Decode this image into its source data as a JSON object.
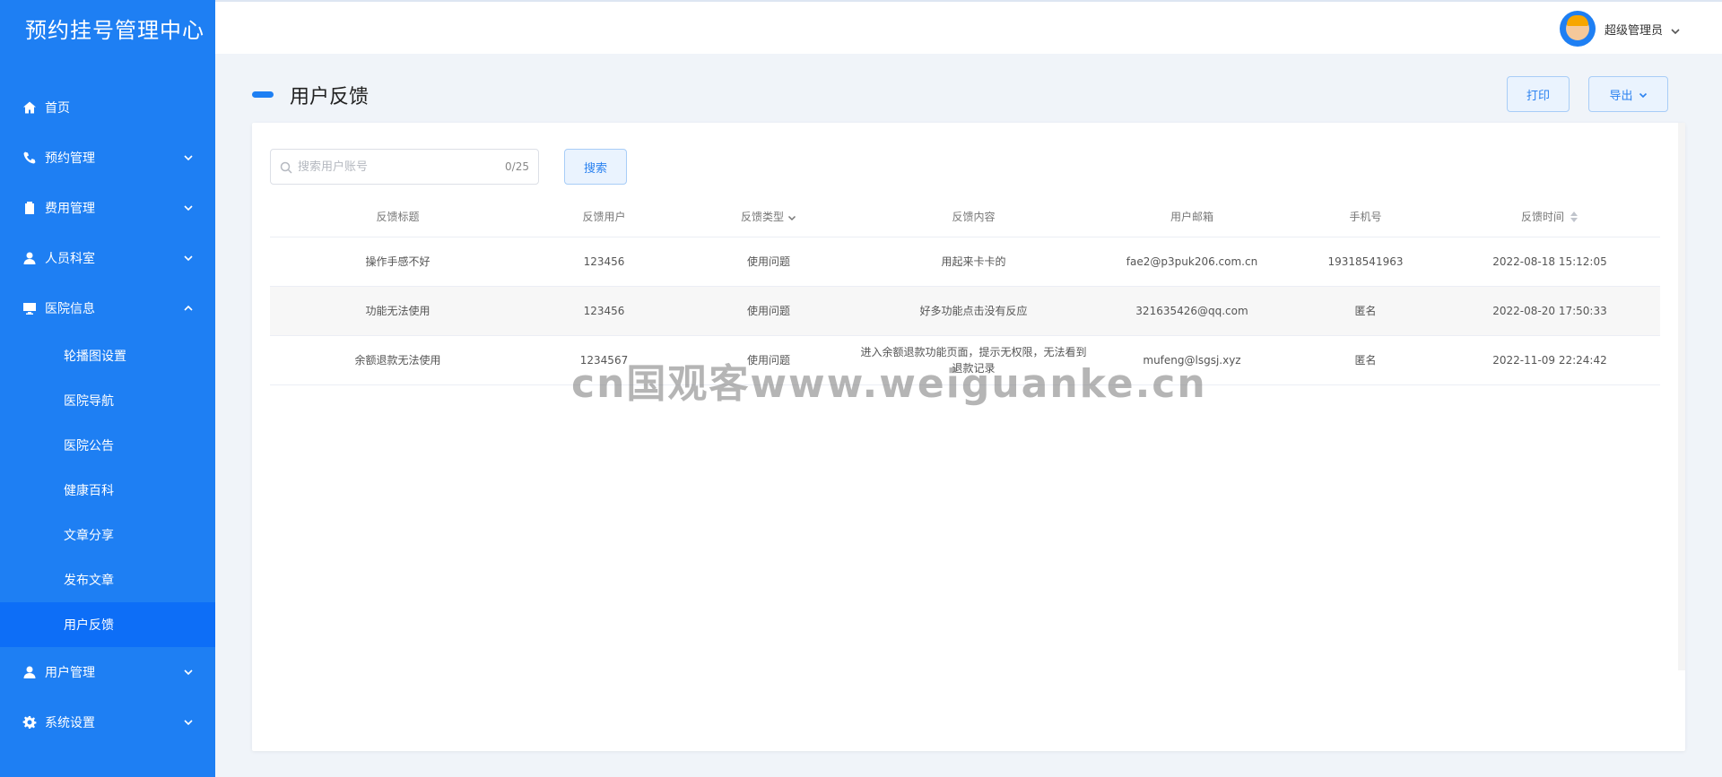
{
  "app": {
    "brand": "预约挂号管理中心"
  },
  "sidebar": {
    "items": [
      {
        "label": "首页",
        "icon": "home-icon"
      },
      {
        "label": "预约管理",
        "icon": "phone-icon"
      },
      {
        "label": "费用管理",
        "icon": "clipboard-icon"
      },
      {
        "label": "人员科室",
        "icon": "user-icon"
      },
      {
        "label": "医院信息",
        "icon": "monitor-icon",
        "expanded": true,
        "children": [
          "轮播图设置",
          "医院导航",
          "医院公告",
          "健康百科",
          "文章分享",
          "发布文章",
          "用户反馈"
        ],
        "active_child": "用户反馈"
      },
      {
        "label": "用户管理",
        "icon": "user-icon"
      },
      {
        "label": "系统设置",
        "icon": "gear-icon"
      }
    ]
  },
  "header": {
    "user_name": "超级管理员"
  },
  "page": {
    "title": "用户反馈",
    "print_label": "打印",
    "export_label": "导出"
  },
  "search": {
    "placeholder": "搜索用户账号",
    "count": "0/25",
    "button": "搜索"
  },
  "table": {
    "headers": [
      "反馈标题",
      "反馈用户",
      "反馈类型",
      "反馈内容",
      "用户邮箱",
      "手机号",
      "反馈时间"
    ],
    "rows": [
      [
        "操作手感不好",
        "123456",
        "使用问题",
        "用起来卡卡的",
        "fae2@p3puk206.com.cn",
        "19318541963",
        "2022-08-18 15:12:05"
      ],
      [
        "功能无法使用",
        "123456",
        "使用问题",
        "好多功能点击没有反应",
        "321635426@qq.com",
        "匿名",
        "2022-08-20 17:50:33"
      ],
      [
        "余额退款无法使用",
        "1234567",
        "使用问题",
        "进入余额退款功能页面，提示无权限，无法看到退款记录",
        "mufeng@lsgsj.xyz",
        "匿名",
        "2022-11-09 22:24:42"
      ]
    ]
  },
  "watermark": "cn国观客www.weiguanke.cn",
  "colors": {
    "primary": "#1e7ff3",
    "active": "#0d6ef7"
  }
}
